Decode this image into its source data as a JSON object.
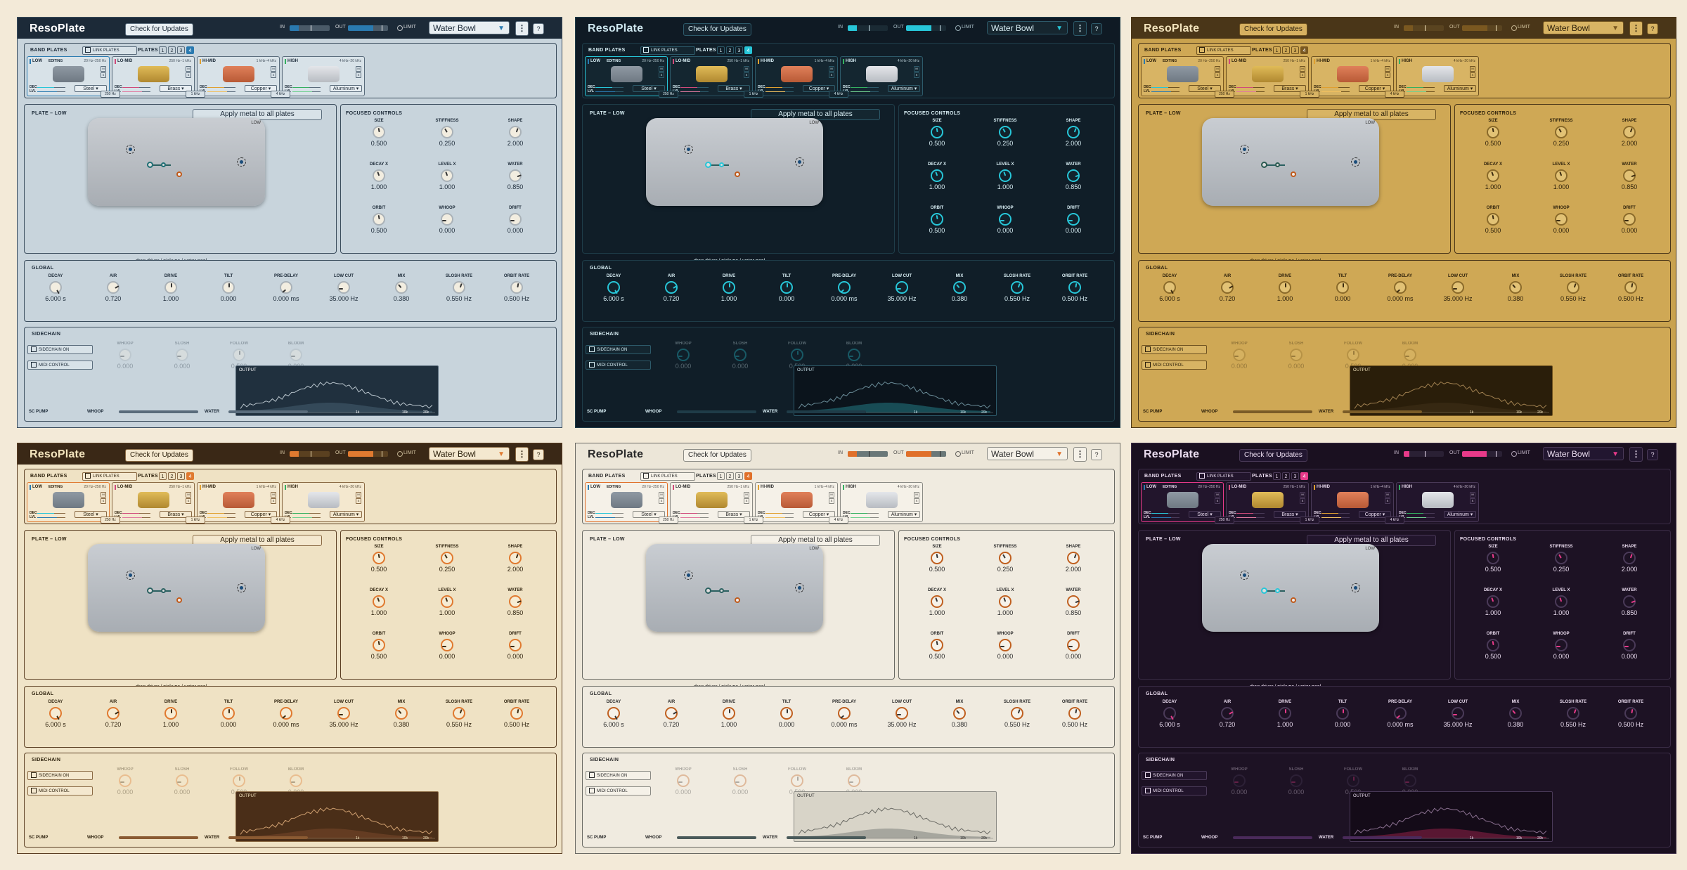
{
  "app": {
    "name": "ResoPlate",
    "update_button": "Check for Updates",
    "in_label": "IN",
    "out_label": "OUT",
    "limit_label": "LIMIT",
    "preset": "Water Bowl",
    "menu_glyph": "⋮",
    "help_glyph": "?"
  },
  "band_plates": {
    "title": "BAND PLATES",
    "link_label": "LINK PLATES",
    "plates_label": "PLATES",
    "plate_counts": [
      "1",
      "2",
      "3",
      "4"
    ],
    "editing_badge": "EDITING",
    "dec_label": "DEC",
    "lvl_label": "LVL",
    "m_label": "M",
    "s_label": "S",
    "bands": [
      {
        "name": "LOW",
        "range": "20 Hz–250 Hz",
        "material": "Steel"
      },
      {
        "name": "LO-MID",
        "range": "250 Hz–1 kHz",
        "material": "Brass"
      },
      {
        "name": "HI-MID",
        "range": "1 kHz–4 kHz",
        "material": "Copper"
      },
      {
        "name": "HIGH",
        "range": "4 kHz–20 kHz",
        "material": "Aluminum"
      }
    ],
    "crossovers": [
      "250 Hz",
      "1 kHz",
      "4 kHz"
    ]
  },
  "plate_view": {
    "title": "PLATE – LOW",
    "apply_button": "Apply metal to all plates",
    "plate_tag": "LOW",
    "caption": "drag driver / pickups / water pool"
  },
  "focused": {
    "title": "FOCUSED CONTROLS",
    "knobs": [
      {
        "label": "SIZE",
        "value": "0.500"
      },
      {
        "label": "STIFFNESS",
        "value": "0.250"
      },
      {
        "label": "SHAPE",
        "value": "2.000"
      },
      {
        "label": "DECAY X",
        "value": "1.000"
      },
      {
        "label": "LEVEL X",
        "value": "1.000"
      },
      {
        "label": "WATER",
        "value": "0.850"
      },
      {
        "label": "ORBIT",
        "value": "0.500"
      },
      {
        "label": "WHOOP",
        "value": "0.000"
      },
      {
        "label": "DRIFT",
        "value": "0.000"
      }
    ]
  },
  "global": {
    "title": "GLOBAL",
    "knobs": [
      {
        "label": "DECAY",
        "value": "6.000 s"
      },
      {
        "label": "AIR",
        "value": "0.720"
      },
      {
        "label": "DRIVE",
        "value": "1.000"
      },
      {
        "label": "TILT",
        "value": "0.000"
      },
      {
        "label": "PRE-DELAY",
        "value": "0.000 ms"
      },
      {
        "label": "LOW CUT",
        "value": "35.000 Hz"
      },
      {
        "label": "MIX",
        "value": "0.380"
      },
      {
        "label": "SLOSH RATE",
        "value": "0.550 Hz"
      },
      {
        "label": "ORBIT RATE",
        "value": "0.500 Hz"
      }
    ]
  },
  "sidechain": {
    "title": "SIDECHAIN",
    "sidechain_on": "SIDECHAIN ON",
    "midi_control": "MIDI CONTROL",
    "knobs": [
      {
        "label": "WHOOP",
        "value": "0.000"
      },
      {
        "label": "SLOSH",
        "value": "0.000"
      },
      {
        "label": "FOLLOW",
        "value": "0.500"
      },
      {
        "label": "BLOOM",
        "value": "0.000"
      }
    ],
    "output_label": "OUTPUT",
    "output_ticks": [
      "20",
      "100",
      "1k",
      "10k",
      "20k"
    ],
    "sc_pump": "SC PUMP",
    "whoop": "WHOOP",
    "water": "WATER"
  },
  "themes": [
    {
      "bg": "#c8d4dc",
      "top": "#1c2a38",
      "topText": "#ffffff",
      "panel": "#c8d4dc",
      "panel2": "#d8e2e8",
      "line": "#5a6c7c",
      "line2": "#3a4c5c",
      "text": "#1c2a38",
      "accent": "#2a7ab0",
      "accent2": "#1f6f74",
      "updBg": "#e8eef2",
      "updText": "#1c2a38",
      "presetBg": "#e8eef2",
      "presetText": "#1c2a38",
      "meterBg": "#4a5a68",
      "knobBg": "#f2ede0",
      "knobRing": "#aab2b8",
      "knobPtr": "#333333",
      "outBg": "#20303e",
      "outText": "#ffffff",
      "barFill": "#5a6c7c",
      "stroke": "#b8c4cc",
      "fillArea": "#3a5060"
    },
    {
      "bg": "#0f1a24",
      "top": "#0f1a24",
      "topText": "#cfe8f0",
      "panel": "#101e28",
      "panel2": "#142630",
      "line": "#2d5a6a",
      "line2": "#1e3c48",
      "text": "#d8eef4",
      "accent": "#27c6d8",
      "accent2": "#27c6d8",
      "updBg": "#152530",
      "updText": "#d8eef4",
      "presetBg": "#16262f",
      "presetText": "#d8eef4",
      "meterBg": "#1a2a34",
      "knobBg": "#12222c",
      "knobRing": "#27c6d8",
      "knobPtr": "#27c6d8",
      "outBg": "#0b141c",
      "outText": "#cfe8f0",
      "barFill": "#1f3c48",
      "stroke": "#6a8c98",
      "fillArea": "#1b5a64"
    },
    {
      "bg": "#c9a24e",
      "top": "#4a3618",
      "topText": "#f3e4bd",
      "panel": "#cfa855",
      "panel2": "#d8b464",
      "line": "#6e5220",
      "line2": "#4a3618",
      "text": "#2a1e0a",
      "accent": "#7a5820",
      "accent2": "#2a5a50",
      "updBg": "#d6b060",
      "updText": "#2a1e0a",
      "presetBg": "#d8b464",
      "presetText": "#2a1e0a",
      "meterBg": "#5a4420",
      "knobBg": "#e2c275",
      "knobRing": "#8a6a2a",
      "knobPtr": "#3a2a10",
      "outBg": "#2a1e0a",
      "outText": "#f3e4bd",
      "barFill": "#7a5c28",
      "stroke": "#a08050",
      "fillArea": "#3a2a14"
    },
    {
      "bg": "#f0e4c8",
      "top": "#3a2816",
      "topText": "#f3e4bd",
      "panel": "#efe2c4",
      "panel2": "#f4e8cf",
      "line": "#8a6a44",
      "line2": "#5a3e22",
      "text": "#2a1e0a",
      "accent": "#e07a30",
      "accent2": "#2a6060",
      "updBg": "#f4e8cf",
      "updText": "#2a1e0a",
      "presetBg": "#f4e8cf",
      "presetText": "#2a1e0a",
      "meterBg": "#5a4020",
      "knobBg": "#f6ecd4",
      "knobRing": "#e07a30",
      "knobPtr": "#3a2a10",
      "outBg": "#4a2e18",
      "outText": "#f3e4bd",
      "barFill": "#8a5a32",
      "stroke": "#d0a070",
      "fillArea": "#6a4026"
    },
    {
      "bg": "#ece6d8",
      "top": "#ece6d8",
      "topText": "#2a2a2a",
      "panel": "#f0ebe0",
      "panel2": "#f5f1e8",
      "line": "#8a8a84",
      "line2": "#6a6a64",
      "text": "#2a2a2a",
      "accent": "#e0702a",
      "accent2": "#2a6060",
      "updBg": "#f5f1e8",
      "updText": "#2a2a2a",
      "presetBg": "#f5f1e8",
      "presetText": "#2a2a2a",
      "meterBg": "#6a7878",
      "knobBg": "#f6f2ea",
      "knobRing": "#c06020",
      "knobPtr": "#333333",
      "outBg": "#d8d4c8",
      "outText": "#2a2a2a",
      "barFill": "#4a5a5a",
      "stroke": "#6a6a64",
      "fillArea": "#9a9a94"
    },
    {
      "bg": "#1a1020",
      "top": "#1a1020",
      "topText": "#eadcef",
      "panel": "#1d1224",
      "panel2": "#22152c",
      "line": "#4a3a58",
      "line2": "#3a2c46",
      "text": "#eadcef",
      "accent": "#e83a8a",
      "accent2": "#27c6d8",
      "updBg": "#221630",
      "updText": "#eadcef",
      "presetBg": "#221630",
      "presetText": "#eadcef",
      "meterBg": "#2a2034",
      "knobBg": "#1d1224",
      "knobRing": "#4a3a58",
      "knobPtr": "#e83a8a",
      "outBg": "#140b18",
      "outText": "#eadcef",
      "barFill": "#4a2a5a",
      "stroke": "#8a7090",
      "fillArea": "#6a1a3a"
    }
  ]
}
